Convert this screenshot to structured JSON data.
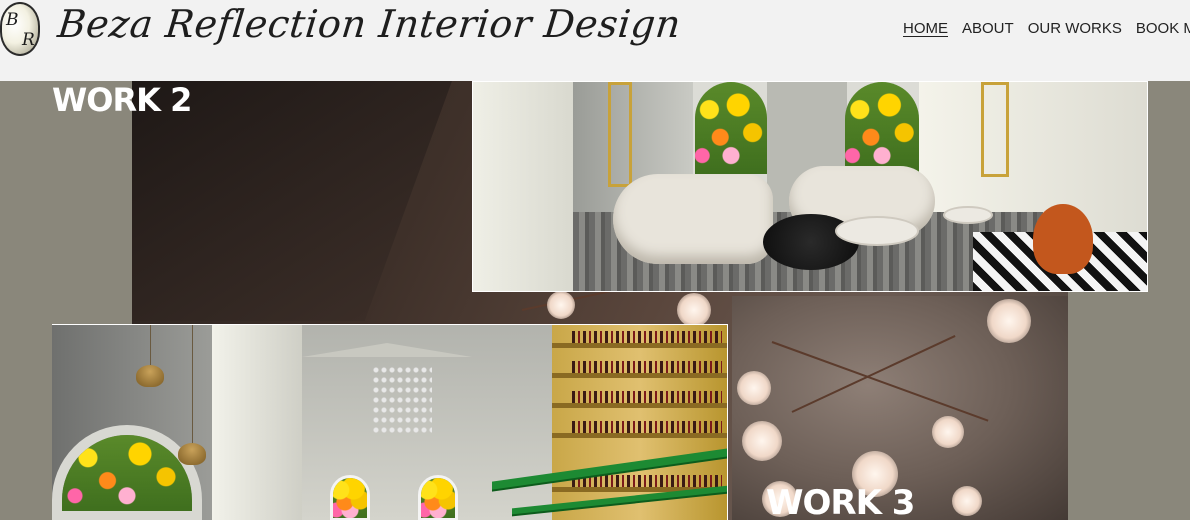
{
  "header": {
    "logo_letters": [
      "B",
      "R"
    ],
    "site_title": "Beza Reflection Interior Design",
    "nav": [
      {
        "label": "HOME",
        "active": true
      },
      {
        "label": "ABOUT",
        "active": false
      },
      {
        "label": "OUR WORKS",
        "active": false
      },
      {
        "label": "BOOK M",
        "active": false
      }
    ]
  },
  "gallery": {
    "work2_label": "WORK 2",
    "work3_label": "WORK 3"
  },
  "colors": {
    "header_bg": "#f2f2f2",
    "page_bg": "#8a877b",
    "label_text": "#ffffff"
  }
}
